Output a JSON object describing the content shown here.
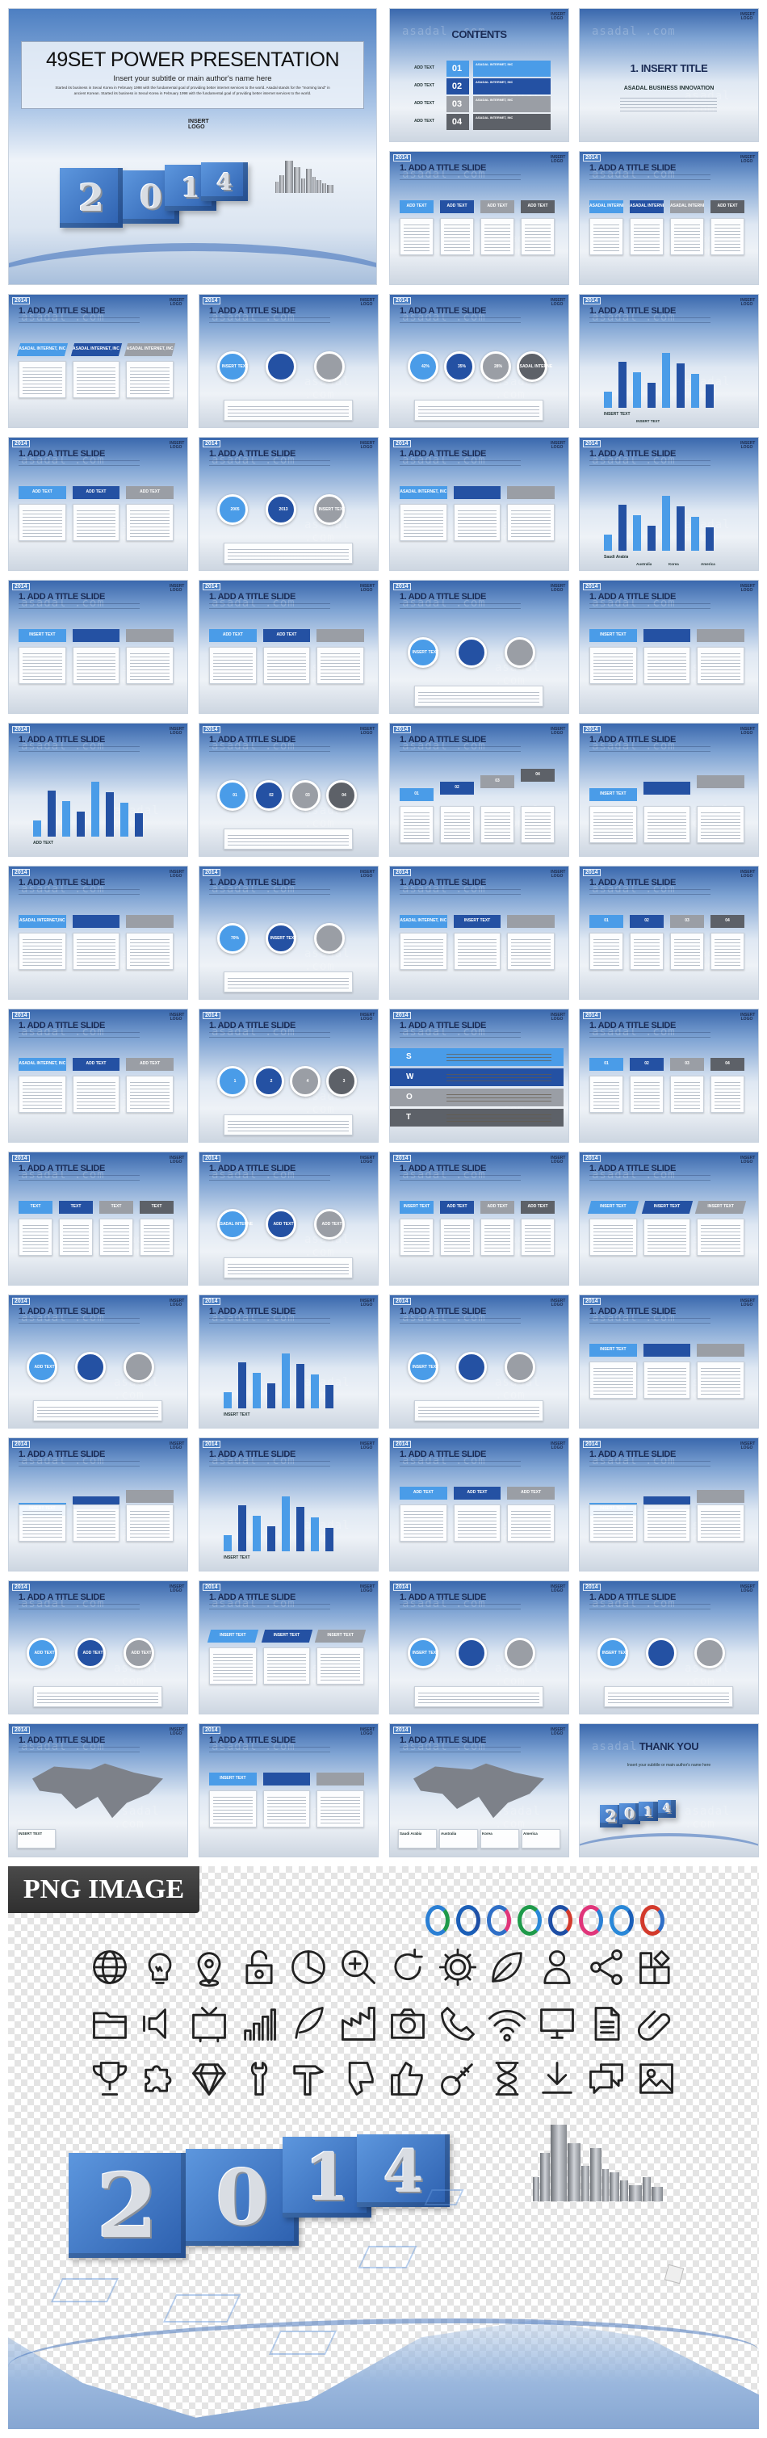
{
  "watermark": "asadal .com",
  "hero": {
    "title": "49SET POWER PRESENTATION",
    "subtitle": "Insert your subtitle or main author's name here",
    "body": "Started its business in Seoul Korea in February 1998 with the fundamental goal of providing better internet services to the world. Asadal stands for the \"morning land\" in ancient Korean. Started its business in Seoul Korea in February 1998 with the fundamental goal of providing better internet services to the world.",
    "logo": "INSERT LOGO",
    "year": [
      "2",
      "0",
      "1",
      "4"
    ]
  },
  "common": {
    "badge": "2014",
    "logo": "INSERT LOGO",
    "slide_title": "1. ADD A TITLE SLIDE"
  },
  "slides": [
    {
      "title": "CONTENTS",
      "layout": "contents",
      "labels": [
        "01",
        "02",
        "03",
        "04",
        "ADD TEXT",
        "ASADAL INTERNET, INC"
      ]
    },
    {
      "title": "1. INSERT TITLE",
      "layout": "section",
      "labels": [
        "ASADAL BUSINESS INNOVATION"
      ]
    },
    {
      "layout": "icons4",
      "labels": [
        "ADD TEXT",
        "ADD TEXT",
        "ADD TEXT",
        "ADD TEXT"
      ]
    },
    {
      "layout": "wave3",
      "labels": [
        "ASADAL INTERNET,INC",
        "ASADAL INTERNET,INC",
        "ASADAL INTERNET,INC",
        "ADD TEXT"
      ]
    },
    {
      "layout": "arrows",
      "labels": [
        "ASADAL INTERNET, INC",
        "ASADAL INTERNET, INC",
        "ASADAL INTERNET, INC"
      ]
    },
    {
      "layout": "hex",
      "labels": [
        "INSERT TEXT"
      ]
    },
    {
      "layout": "circles",
      "labels": [
        "42%",
        "35%",
        "28%",
        "ASADAL INTERNET, INC"
      ]
    },
    {
      "layout": "line",
      "labels": [
        "INSERT TEXT",
        "INSERT TEXT"
      ]
    },
    {
      "layout": "boxes",
      "labels": [
        "ADD TEXT",
        "ADD TEXT",
        "ADD TEXT"
      ]
    },
    {
      "layout": "donut",
      "labels": [
        "2005",
        "2013",
        "INSERT TEXT"
      ]
    },
    {
      "layout": "puzzle",
      "labels": [
        "ASADAL INTERNET, INC"
      ]
    },
    {
      "layout": "line",
      "labels": [
        "Saudi Arabia",
        "Australia",
        "Korea",
        "America"
      ]
    },
    {
      "layout": "steps",
      "labels": [
        "INSERT TEXT"
      ]
    },
    {
      "layout": "cards",
      "labels": [
        "ADD TEXT",
        "ADD TEXT"
      ]
    },
    {
      "layout": "cycle",
      "labels": [
        "INSERT TEXT"
      ]
    },
    {
      "layout": "letter",
      "labels": [
        "INSERT TEXT"
      ]
    },
    {
      "layout": "bars",
      "labels": [
        "ADD TEXT"
      ]
    },
    {
      "layout": "quad",
      "labels": [
        "01",
        "02",
        "03",
        "04"
      ]
    },
    {
      "layout": "pyramid",
      "labels": [
        "01",
        "02",
        "03",
        "04"
      ]
    },
    {
      "layout": "pyramid2",
      "labels": [
        "INSERT TEXT"
      ]
    },
    {
      "layout": "boxes3",
      "labels": [
        "ASADAL INTERNET,INC"
      ]
    },
    {
      "layout": "rings",
      "labels": [
        "70%",
        "INSERT TEXT"
      ]
    },
    {
      "layout": "cube",
      "labels": [
        "ASADAL INTERNET, INC",
        "INSERT TEXT"
      ]
    },
    {
      "layout": "head",
      "labels": [
        "01",
        "02",
        "03",
        "04"
      ]
    },
    {
      "layout": "boxes",
      "labels": [
        "ASADAL INTERNET, INC",
        "ADD TEXT",
        "ADD TEXT"
      ]
    },
    {
      "layout": "quad",
      "labels": [
        "1",
        "2",
        "4",
        "3"
      ]
    },
    {
      "layout": "swot",
      "labels": [
        "S",
        "W",
        "O",
        "T"
      ]
    },
    {
      "layout": "people",
      "labels": [
        "01",
        "02",
        "03",
        "04"
      ]
    },
    {
      "layout": "pills",
      "labels": [
        "TEXT",
        "TEXT",
        "TEXT",
        "TEXT"
      ]
    },
    {
      "layout": "cycle",
      "labels": [
        "ASADAL INTERNET, INC",
        "ADD TEXT",
        "ADD TEXT"
      ]
    },
    {
      "layout": "arrowsup",
      "labels": [
        "INSERT TEXT",
        "ADD TEXT",
        "ADD TEXT",
        "ADD TEXT"
      ]
    },
    {
      "layout": "ribbon",
      "labels": [
        "INSERT TEXT",
        "INSERT TEXT",
        "INSERT TEXT"
      ]
    },
    {
      "layout": "pinwheel",
      "labels": [
        "ADD TEXT"
      ]
    },
    {
      "layout": "bars",
      "labels": [
        "INSERT TEXT"
      ]
    },
    {
      "layout": "globe",
      "labels": [
        "INSERT TEXT"
      ]
    },
    {
      "layout": "table",
      "labels": [
        "INSERT TEXT"
      ]
    },
    {
      "layout": "triangle",
      "labels": [
        "INSERT TEXT"
      ]
    },
    {
      "layout": "bars",
      "labels": [
        "INSERT TEXT"
      ]
    },
    {
      "layout": "boxes",
      "labels": [
        "ADD TEXT",
        "ADD TEXT",
        "ADD TEXT"
      ]
    },
    {
      "layout": "diamond",
      "labels": [
        "INSERT TEXT"
      ]
    },
    {
      "layout": "circles",
      "labels": [
        "ADD TEXT",
        "ADD TEXT",
        "ADD TEXT"
      ]
    },
    {
      "layout": "ribbon",
      "labels": [
        "INSERT TEXT",
        "INSERT TEXT",
        "INSERT TEXT"
      ]
    },
    {
      "layout": "gears",
      "labels": [
        "INSERT TEXT"
      ]
    },
    {
      "layout": "semicircle",
      "labels": [
        "INSERT TEXT"
      ]
    },
    {
      "layout": "korea",
      "labels": [
        "INSERT TEXT"
      ]
    },
    {
      "layout": "video",
      "labels": [
        "INSERT TEXT"
      ]
    },
    {
      "layout": "map",
      "labels": [
        "Saudi Arabia",
        "Australia",
        "Korea",
        "America"
      ]
    },
    {
      "title": "THANK YOU",
      "layout": "thanks",
      "labels": [
        "Insert your subtitle or main author's name here"
      ]
    }
  ],
  "png_section": {
    "label": "PNG IMAGE",
    "logo_colors": [
      "#2a7fd4",
      "#1b5fb8",
      "#2f6fc7",
      "#1f9a4a",
      "#1e4fa6",
      "#e0357a",
      "#2a88d8",
      "#d33a2c"
    ],
    "icons": [
      [
        "globe-icon",
        "lightbulb-icon",
        "map-pin-icon",
        "unlock-icon",
        "pie-chart-icon",
        "zoom-in-icon",
        "refresh-icon",
        "gear-icon",
        "leaf-icon",
        "person-icon",
        "share-icon",
        "blocks-icon"
      ],
      [
        "folder-icon",
        "speaker-icon",
        "tv-icon",
        "bar-chart-icon",
        "feather-icon",
        "factory-icon",
        "camera-icon",
        "phone-icon",
        "wifi-icon",
        "monitor-icon",
        "document-icon",
        "paperclip-icon"
      ],
      [
        "trophy-icon",
        "puzzle-icon",
        "diamond-icon",
        "wrench-icon",
        "hammer-icon",
        "thumbs-down-icon",
        "thumbs-up-icon",
        "key-icon",
        "hourglass-icon",
        "download-icon",
        "chat-icon",
        "image-icon"
      ]
    ],
    "year": [
      "2",
      "0",
      "1",
      "4"
    ]
  },
  "colors": {
    "brand_blue": "#2c5fae",
    "dark_navy": "#1a2b55",
    "light_blue": "#4a9ce8"
  }
}
